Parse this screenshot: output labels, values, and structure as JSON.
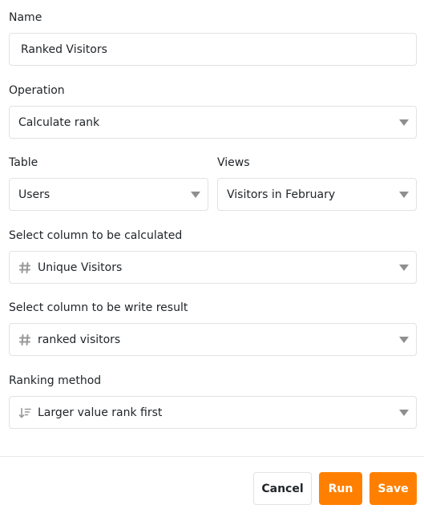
{
  "name": {
    "label": "Name",
    "value": "Ranked Visitors"
  },
  "operation": {
    "label": "Operation",
    "value": "Calculate rank"
  },
  "table": {
    "label": "Table",
    "value": "Users"
  },
  "views": {
    "label": "Views",
    "value": "Visitors in February"
  },
  "calc_column": {
    "label": "Select column to be calculated",
    "value": "Unique Visitors",
    "icon": "number-column-icon"
  },
  "result_column": {
    "label": "Select column to be write result",
    "value": "ranked visitors",
    "icon": "number-column-icon"
  },
  "ranking_method": {
    "label": "Ranking method",
    "value": "Larger value rank first",
    "icon": "sort-descending-icon"
  },
  "footer": {
    "cancel_label": "Cancel",
    "run_label": "Run",
    "save_label": "Save"
  },
  "colors": {
    "accent": "#ff8000",
    "border": "#e2e2e2",
    "caret": "#8f8f8f",
    "icon": "#999999"
  }
}
